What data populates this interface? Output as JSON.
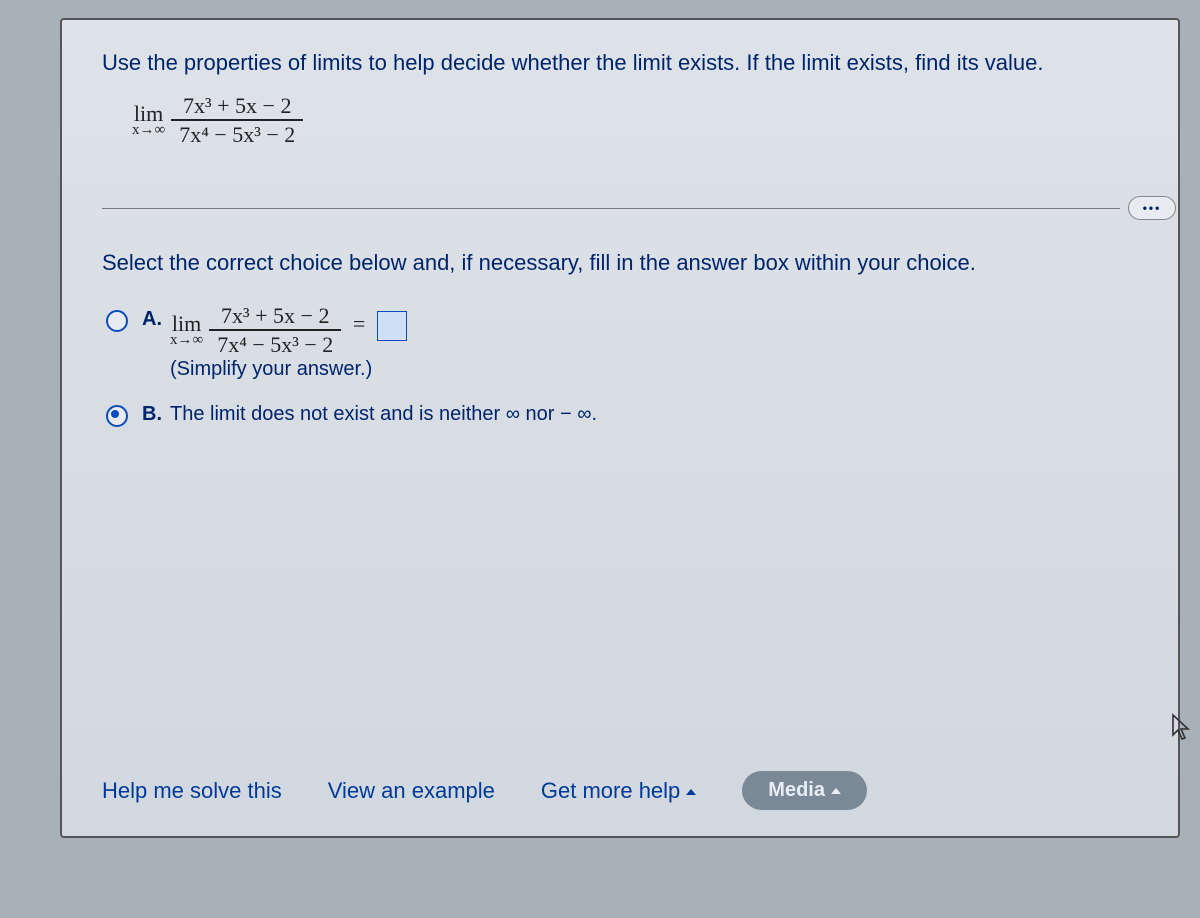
{
  "question": "Use the properties of limits to help decide whether the limit exists. If the limit exists, find its value.",
  "main_limit": {
    "lim_label": "lim",
    "lim_sub": "x→∞",
    "numerator": "7x³ + 5x − 2",
    "denominator": "7x⁴ − 5x³ − 2"
  },
  "more_button": "•••",
  "instruction": "Select the correct choice below and, if necessary, fill in the answer box within your choice.",
  "choices": {
    "a": {
      "label": "A.",
      "lim_label": "lim",
      "lim_sub": "x→∞",
      "numerator": "7x³ + 5x − 2",
      "denominator": "7x⁴ − 5x³ − 2",
      "equals": "=",
      "hint": "(Simplify your answer.)",
      "selected": false
    },
    "b": {
      "label": "B.",
      "text": "The limit does not exist and is neither ∞ nor − ∞.",
      "selected": true
    }
  },
  "footer": {
    "help": "Help me solve this",
    "example": "View an example",
    "more_help": "Get more help",
    "media": "Media"
  }
}
